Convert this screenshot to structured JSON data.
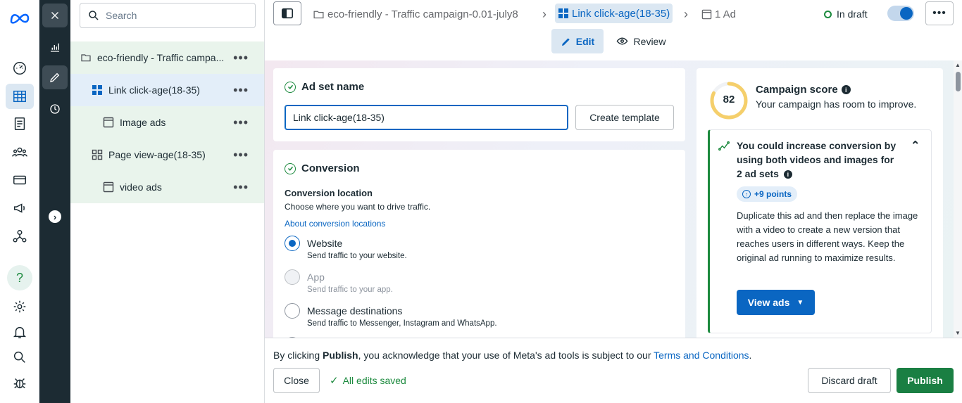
{
  "tree": {
    "search_placeholder": "Search",
    "items": [
      {
        "label": "eco-friendly - Traffic campa...",
        "icon": "folder-icon"
      },
      {
        "label": "Link click-age(18-35)",
        "icon": "adset-icon"
      },
      {
        "label": "Image ads",
        "icon": "ad-icon"
      },
      {
        "label": "Page view-age(18-35)",
        "icon": "adset-icon"
      },
      {
        "label": "video ads",
        "icon": "ad-icon"
      }
    ]
  },
  "breadcrumb": {
    "campaign": "eco-friendly - Traffic campaign-0.01-july8",
    "adset": "Link click-age(18-35)",
    "ad": "1 Ad"
  },
  "status": {
    "label": "In draft"
  },
  "modes": {
    "edit": "Edit",
    "review": "Review"
  },
  "adset_name": {
    "title": "Ad set name",
    "value": "Link click-age(18-35)",
    "create_template": "Create template"
  },
  "conversion": {
    "title": "Conversion",
    "location_label": "Conversion location",
    "location_help": "Choose where you want to drive traffic.",
    "about_link": "About conversion locations",
    "options": [
      {
        "label": "Website",
        "desc": "Send traffic to your website.",
        "selected": true
      },
      {
        "label": "App",
        "desc": "Send traffic to your app.",
        "disabled": true
      },
      {
        "label": "Message destinations",
        "desc": "Send traffic to Messenger, Instagram and WhatsApp."
      }
    ]
  },
  "score": {
    "value": "82",
    "title": "Campaign score",
    "subtitle": "Your campaign has room to improve.",
    "rec_title": "You could increase conversion by using both videos and images for 2 ad sets",
    "points": "+9 points",
    "rec_body": "Duplicate this ad and then replace the image with a video to create a new version that reaches users in different ways. Keep the original ad running to maximize results.",
    "view_ads": "View ads"
  },
  "footer": {
    "notice_pre": "By clicking ",
    "notice_bold": "Publish",
    "notice_mid": ", you acknowledge that your use of Meta's ad tools is subject to our ",
    "terms": "Terms and Conditions",
    "notice_end": ".",
    "close": "Close",
    "saved": "All edits saved",
    "discard": "Discard draft",
    "publish": "Publish"
  },
  "colors": {
    "accent": "#0a66c2",
    "publish": "#1a7f43",
    "green": "#1c8a3e",
    "dark": "#1c2b33"
  }
}
